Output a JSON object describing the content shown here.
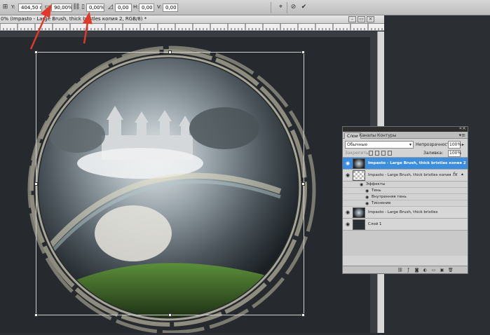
{
  "options_bar": {
    "y_label": "Y:",
    "y_value": "404,50 пикс",
    "width_value": "90,00%",
    "height_value": "0,00%",
    "angle_value": "0,00",
    "h_label": "H:",
    "h_value": "0,00",
    "v_label": "V:",
    "v_value": "0,00",
    "icons": [
      "reference-point-icon",
      "link-icon",
      "angle-icon",
      "warp-icon",
      "cancel-icon",
      "commit-icon"
    ]
  },
  "document": {
    "title": "0% (Impasto - Large Brush, thick bristles копия 2, RGB/8) *"
  },
  "layers_panel": {
    "tabs": [
      "Слои",
      "Каналы",
      "Контуры"
    ],
    "blend_mode": "Обычные",
    "opacity_label": "Непрозрачность:",
    "opacity_value": "100%",
    "lock_label": "Закрепить:",
    "fill_label": "Заливка:",
    "fill_value": "100%",
    "layers": [
      {
        "name": "Impasto - Large Brush, thick bristles копия 2",
        "active": true,
        "thumb": "image"
      },
      {
        "name": "Impasto - Large Brush, thick bristles копия",
        "active": false,
        "thumb": "transparent",
        "fx": "fx"
      },
      {
        "name": "Impasto - Large Brush, thick bristles",
        "active": false,
        "thumb": "image"
      },
      {
        "name": "Слой 1",
        "active": false,
        "thumb": "dark"
      }
    ],
    "effects_label": "Эффекты",
    "effects": [
      "Тень",
      "Внутренняя тень",
      "Тиснение"
    ]
  },
  "colors": {
    "active_layer": "#3c8dde",
    "workspace": "#3a3e42",
    "canvas": "#262a2e",
    "annotation_arrow": "#e0392b"
  }
}
